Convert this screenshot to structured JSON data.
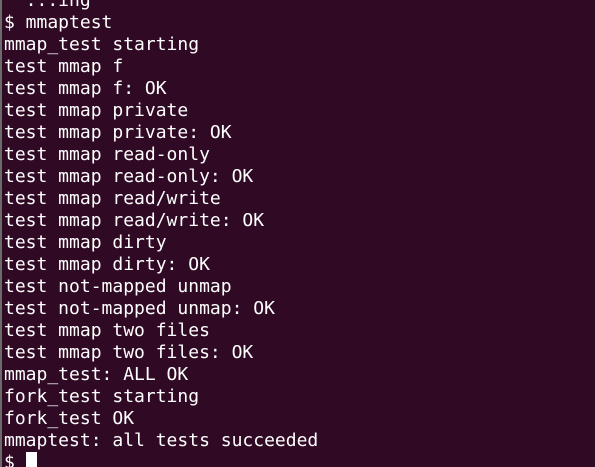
{
  "terminal": {
    "lines": [
      "  ...ing",
      "$ mmaptest",
      "mmap_test starting",
      "test mmap f",
      "test mmap f: OK",
      "test mmap private",
      "test mmap private: OK",
      "test mmap read-only",
      "test mmap read-only: OK",
      "test mmap read/write",
      "test mmap read/write: OK",
      "test mmap dirty",
      "test mmap dirty: OK",
      "test not-mapped unmap",
      "test not-mapped unmap: OK",
      "test mmap two files",
      "test mmap two files: OK",
      "mmap_test: ALL OK",
      "fork_test starting",
      "fork_test OK",
      "mmaptest: all tests succeeded"
    ],
    "prompt": "$ "
  },
  "colors": {
    "background": "#300a24",
    "foreground": "#ffffff"
  }
}
